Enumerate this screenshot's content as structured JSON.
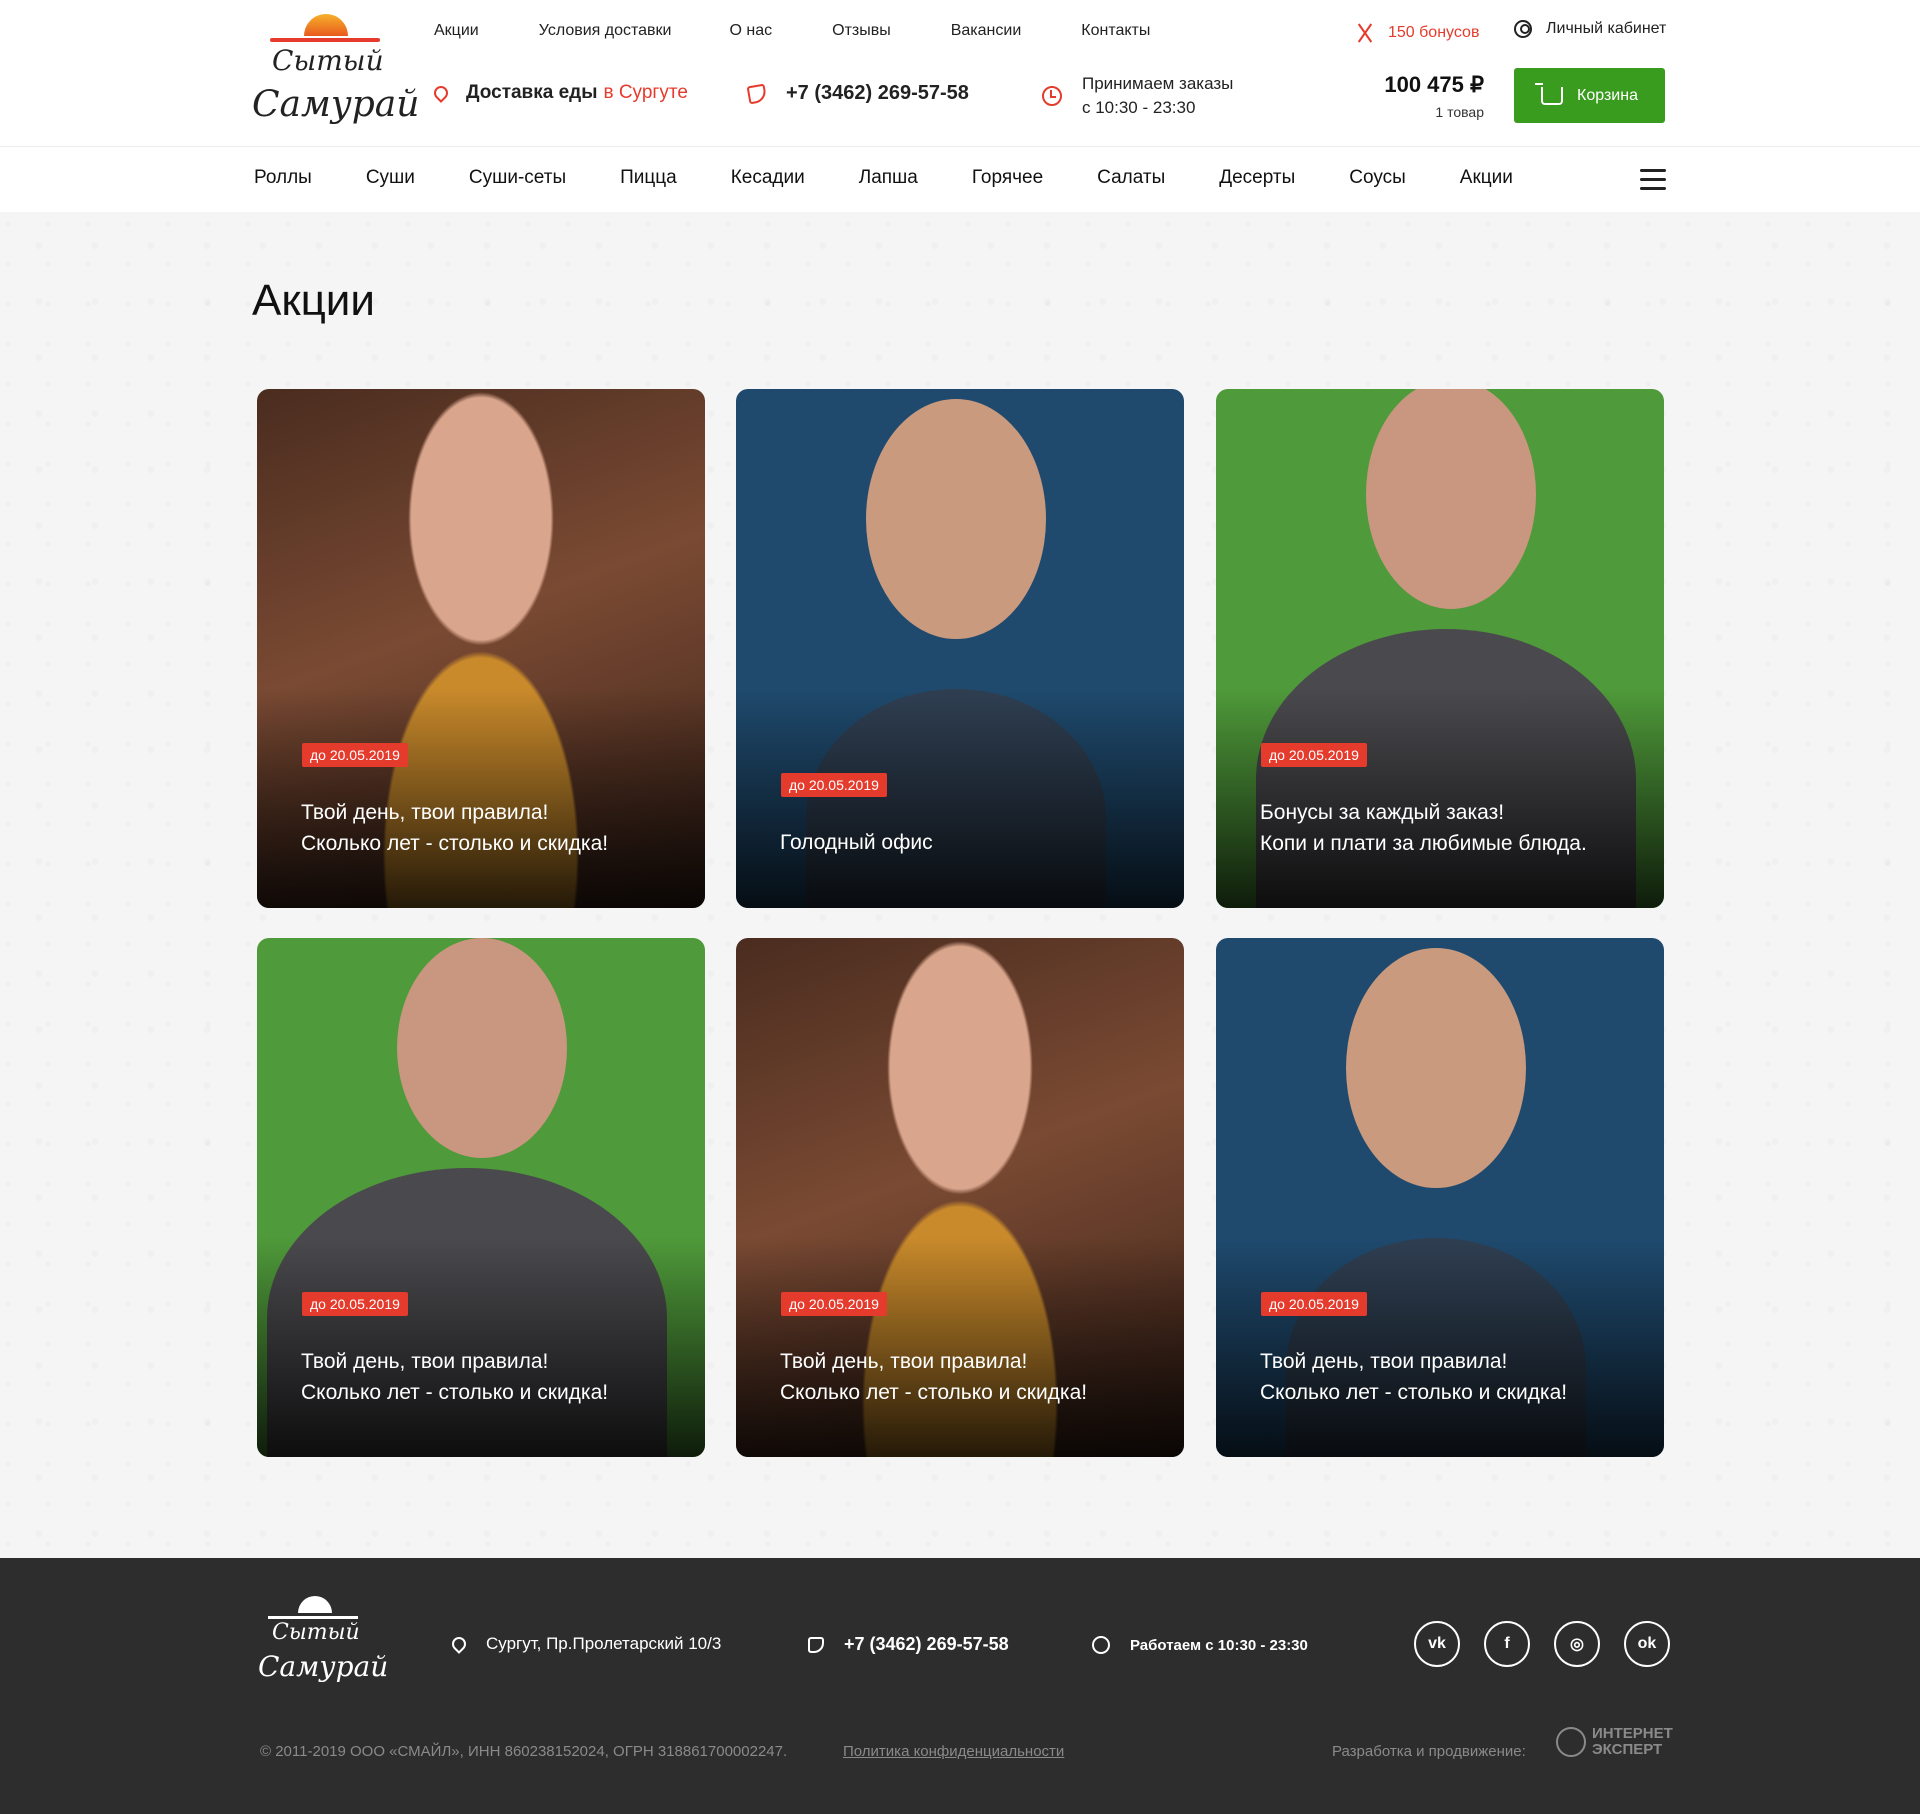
{
  "logo": {
    "line1": "Сытый",
    "line2": "Самурай"
  },
  "topnav": [
    "Акции",
    "Условия доставки",
    "О нас",
    "Отзывы",
    "Вакансии",
    "Контакты"
  ],
  "bonus": {
    "label": "150 бонусов",
    "icon": "chopsticks-icon"
  },
  "account": {
    "label": "Личный кабинет",
    "icon": "user-icon"
  },
  "delivery": {
    "label": "Доставка еды",
    "city": "в Сургуте",
    "icon": "location-pin-icon"
  },
  "phone": {
    "number": "+7 (3462) 269-57-58",
    "icon": "phone-icon"
  },
  "hours": {
    "line1": "Принимаем заказы",
    "line2": "с 10:30 - 23:30",
    "icon": "clock-icon"
  },
  "cart": {
    "total": "100 475 ₽",
    "count": "1 товар",
    "button": "Корзина",
    "icon": "cart-icon"
  },
  "categories": [
    "Роллы",
    "Суши",
    "Суши-сеты",
    "Пицца",
    "Кесадии",
    "Лапша",
    "Горячее",
    "Салаты",
    "Десерты",
    "Соусы",
    "Акции"
  ],
  "page": {
    "title": "Акции"
  },
  "promos": [
    {
      "badge": "до 20.05.2019",
      "line1": "Твой день, твои правила!",
      "line2": "Сколько лет - столько и скидка!"
    },
    {
      "badge": "до 20.05.2019",
      "line1": "Голодный офис",
      "line2": ""
    },
    {
      "badge": "до 20.05.2019",
      "line1": "Бонусы за каждый заказ!",
      "line2": "Копи и плати за любимые блюда."
    },
    {
      "badge": "до 20.05.2019",
      "line1": "Твой день, твои правила!",
      "line2": "Сколько лет - столько и скидка!"
    },
    {
      "badge": "до 20.05.2019",
      "line1": "Твой день, твои правила!",
      "line2": "Сколько лет - столько и скидка!"
    },
    {
      "badge": "до 20.05.2019",
      "line1": "Твой день, твои правила!",
      "line2": "Сколько лет - столько и скидка!"
    }
  ],
  "footer": {
    "address": "Сургут, Пр.Пролетарский 10/3",
    "phone": "+7 (3462) 269-57-58",
    "hours": "Работаем с 10:30 - 23:30",
    "socials": [
      "vk-icon",
      "facebook-icon",
      "instagram-icon",
      "odnoklassniki-icon"
    ],
    "social_glyphs": [
      "vk",
      "f",
      "◎",
      "ok"
    ],
    "copyright": "© 2011-2019  ООО «СМАЙЛ», ИНН 860238152024, ОГРН 318861700002247.",
    "policy": "Политика конфиденциальности",
    "dev_label": "Разработка и продвижение:",
    "dev_brand_1": "ИНТЕРНЕТ",
    "dev_brand_2": "ЭКСПЕРТ"
  },
  "colors": {
    "accent": "#e53b2c",
    "cart_green": "#3a9c1f",
    "footer_bg": "#2d2d2d"
  }
}
